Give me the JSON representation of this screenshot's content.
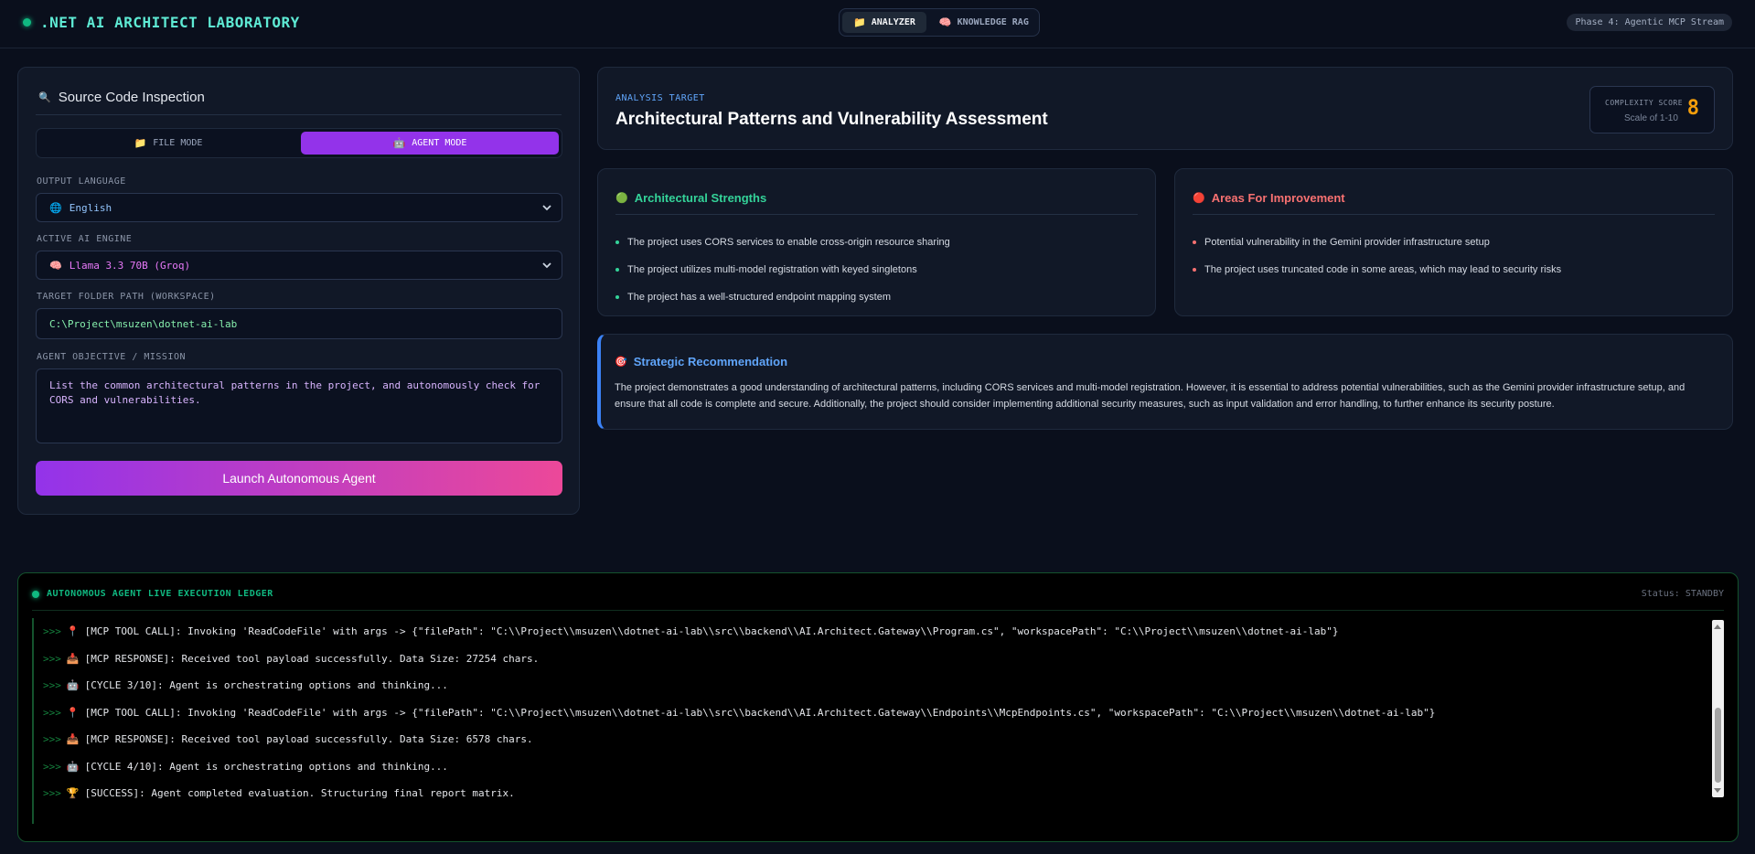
{
  "header": {
    "brand_title": ".NET AI ARCHITECT LABORATORY",
    "tabs": [
      {
        "label": "ANALYZER",
        "icon": "folder-icon",
        "active": true
      },
      {
        "label": "KNOWLEDGE RAG",
        "icon": "brain-icon",
        "active": false
      }
    ],
    "phase_badge": "Phase 4: Agentic MCP Stream"
  },
  "source_panel": {
    "title": "Source Code Inspection",
    "modes": [
      {
        "label": "FILE MODE",
        "icon": "folder-icon",
        "active": false
      },
      {
        "label": "AGENT MODE",
        "icon": "robot-icon",
        "active": true
      }
    ],
    "output_language": {
      "label": "OUTPUT LANGUAGE",
      "value": "English"
    },
    "ai_engine": {
      "label": "ACTIVE AI ENGINE",
      "value": "Llama 3.3 70B (Groq)"
    },
    "target_folder": {
      "label": "TARGET FOLDER PATH (WORKSPACE)",
      "value": "C:\\Project\\msuzen\\dotnet-ai-lab"
    },
    "objective": {
      "label": "AGENT OBJECTIVE / MISSION",
      "value": "List the common architectural patterns in the project, and autonomously check for CORS and vulnerabilities."
    },
    "launch_label": "Launch Autonomous Agent"
  },
  "analysis": {
    "kicker": "ANALYSIS TARGET",
    "title": "Architectural Patterns and Vulnerability Assessment",
    "complexity_label": "COMPLEXITY SCORE",
    "complexity_scale": "Scale of 1-10",
    "complexity_value": "8"
  },
  "strengths": {
    "title": "Architectural Strengths",
    "color": "#34d399",
    "items": [
      "The project uses CORS services to enable cross-origin resource sharing",
      "The project utilizes multi-model registration with keyed singletons",
      "The project has a well-structured endpoint mapping system"
    ]
  },
  "improvements": {
    "title": "Areas For Improvement",
    "color": "#f87171",
    "items": [
      "Potential vulnerability in the Gemini provider infrastructure setup",
      "The project uses truncated code in some areas, which may lead to security risks"
    ]
  },
  "recommendation": {
    "title": "Strategic Recommendation",
    "body": "The project demonstrates a good understanding of architectural patterns, including CORS services and multi-model registration. However, it is essential to address potential vulnerabilities, such as the Gemini provider infrastructure setup, and ensure that all code is complete and secure. Additionally, the project should consider implementing additional security measures, such as input validation and error handling, to further enhance its security posture."
  },
  "console": {
    "title": "AUTONOMOUS AGENT LIVE EXECUTION LEDGER",
    "status": "Status: STANDBY",
    "prefix": ">>>",
    "lines": [
      {
        "icon": "📍",
        "text": "[MCP TOOL CALL]: Invoking 'ReadCodeFile' with args -> {\"filePath\": \"C:\\\\Project\\\\msuzen\\\\dotnet-ai-lab\\\\src\\\\backend\\\\AI.Architect.Gateway\\\\Program.cs\", \"workspacePath\": \"C:\\\\Project\\\\msuzen\\\\dotnet-ai-lab\"}"
      },
      {
        "icon": "📥",
        "text": "[MCP RESPONSE]: Received tool payload successfully. Data Size: 27254 chars."
      },
      {
        "icon": "🤖",
        "text": "[CYCLE 3/10]: Agent is orchestrating options and thinking..."
      },
      {
        "icon": "📍",
        "text": "[MCP TOOL CALL]: Invoking 'ReadCodeFile' with args -> {\"filePath\": \"C:\\\\Project\\\\msuzen\\\\dotnet-ai-lab\\\\src\\\\backend\\\\AI.Architect.Gateway\\\\Endpoints\\\\McpEndpoints.cs\", \"workspacePath\": \"C:\\\\Project\\\\msuzen\\\\dotnet-ai-lab\"}"
      },
      {
        "icon": "📥",
        "text": "[MCP RESPONSE]: Received tool payload successfully. Data Size: 6578 chars."
      },
      {
        "icon": "🤖",
        "text": "[CYCLE 4/10]: Agent is orchestrating options and thinking..."
      },
      {
        "icon": "🏆",
        "text": "[SUCCESS]: Agent completed evaluation. Structuring final report matrix."
      }
    ]
  }
}
